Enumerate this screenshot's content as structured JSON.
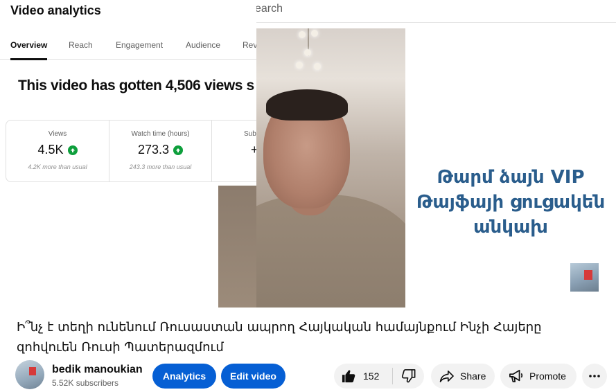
{
  "search": {
    "placeholder_fragment": "earch"
  },
  "analytics": {
    "title": "Video analytics",
    "tabs": [
      {
        "label": "Overview",
        "active": true
      },
      {
        "label": "Reach",
        "active": false
      },
      {
        "label": "Engagement",
        "active": false
      },
      {
        "label": "Audience",
        "active": false
      },
      {
        "label": "Rev",
        "active": false
      }
    ],
    "headline": "This video has gotten 4,506 views s",
    "cards": [
      {
        "label": "Views",
        "value": "4.5K",
        "trend": "up",
        "sub": "4.2K more than usual"
      },
      {
        "label": "Watch time (hours)",
        "value": "273.3",
        "trend": "up",
        "sub": "243.3 more than usual"
      },
      {
        "label": "Subs",
        "value": "+",
        "trend": "",
        "sub": ""
      }
    ]
  },
  "video": {
    "overlay_caption_line1": "Թարմ ձայն VIP",
    "overlay_caption_line2": "Թայֆայի ցուցակեն",
    "overlay_caption_line3": "անկախ",
    "title": "Ի՞նչ է տեղի ունենում Ռուսաստան ապրող Հայկական համայնքում Ինչի Հայերը զոհվուեն Ռուսի Պատերազմում"
  },
  "channel": {
    "name": "bedik manoukian",
    "subscribers": "5.52K subscribers"
  },
  "actions": {
    "analytics_label": "Analytics",
    "edit_label": "Edit video",
    "like_count": "152",
    "share_label": "Share",
    "promote_label": "Promote"
  },
  "colors": {
    "primary_blue": "#065fd4",
    "caption_blue": "#2a5d8c",
    "trend_green": "#0e9f3c",
    "pill_grey": "#f2f2f2"
  },
  "icons": [
    "thumbs-up-icon",
    "thumbs-down-icon",
    "share-arrow-icon",
    "megaphone-icon",
    "more-horizontal-icon",
    "trend-up-icon"
  ]
}
